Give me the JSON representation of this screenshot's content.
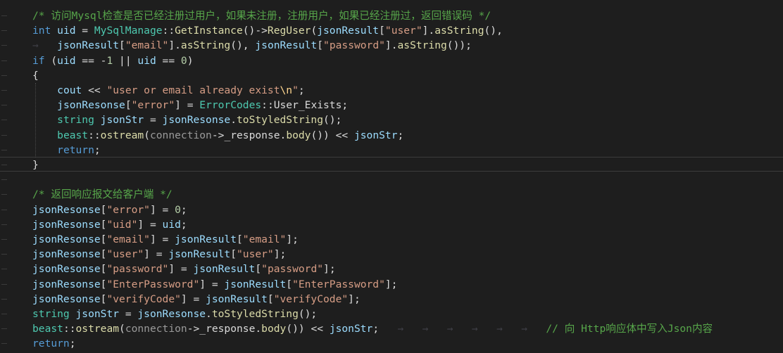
{
  "editor": {
    "background": "#1e1e1e",
    "lines": [
      {
        "tokens": [
          {
            "t": "comment",
            "v": "/* 访问Mysql检查是否已经注册过用户，如果未注册，注册用户，如果已经注册过，返回错误码 */"
          }
        ]
      },
      {
        "tokens": [
          {
            "t": "keyword",
            "v": "int"
          },
          {
            "t": "punct",
            "v": " "
          },
          {
            "t": "var",
            "v": "uid"
          },
          {
            "t": "punct",
            "v": " = "
          },
          {
            "t": "type",
            "v": "MySqlManage"
          },
          {
            "t": "punct",
            "v": "::"
          },
          {
            "t": "func",
            "v": "GetInstance"
          },
          {
            "t": "punct",
            "v": "()->"
          },
          {
            "t": "func",
            "v": "RegUser"
          },
          {
            "t": "punct",
            "v": "("
          },
          {
            "t": "var",
            "v": "jsonResult"
          },
          {
            "t": "punct",
            "v": "["
          },
          {
            "t": "string",
            "v": "\"user\""
          },
          {
            "t": "punct",
            "v": "]."
          },
          {
            "t": "func",
            "v": "asString"
          },
          {
            "t": "punct",
            "v": "(),"
          }
        ]
      },
      {
        "tokens": [
          {
            "t": "tab",
            "v": "→   "
          },
          {
            "t": "var",
            "v": "jsonResult"
          },
          {
            "t": "punct",
            "v": "["
          },
          {
            "t": "string",
            "v": "\"email\""
          },
          {
            "t": "punct",
            "v": "]."
          },
          {
            "t": "func",
            "v": "asString"
          },
          {
            "t": "punct",
            "v": "(), "
          },
          {
            "t": "var",
            "v": "jsonResult"
          },
          {
            "t": "punct",
            "v": "["
          },
          {
            "t": "string",
            "v": "\"password\""
          },
          {
            "t": "punct",
            "v": "]."
          },
          {
            "t": "func",
            "v": "asString"
          },
          {
            "t": "punct",
            "v": "());"
          }
        ]
      },
      {
        "tokens": [
          {
            "t": "keyword",
            "v": "if"
          },
          {
            "t": "punct",
            "v": " ("
          },
          {
            "t": "var",
            "v": "uid"
          },
          {
            "t": "punct",
            "v": " == -"
          },
          {
            "t": "number",
            "v": "1"
          },
          {
            "t": "punct",
            "v": " || "
          },
          {
            "t": "var",
            "v": "uid"
          },
          {
            "t": "punct",
            "v": " == "
          },
          {
            "t": "number",
            "v": "0"
          },
          {
            "t": "punct",
            "v": ")"
          }
        ]
      },
      {
        "tokens": [
          {
            "t": "punct",
            "v": "{"
          }
        ]
      },
      {
        "tokens": [
          {
            "t": "tab",
            "v": "    "
          },
          {
            "t": "var",
            "v": "cout"
          },
          {
            "t": "punct",
            "v": " << "
          },
          {
            "t": "string",
            "v": "\"user or email already exist"
          },
          {
            "t": "escape",
            "v": "\\n"
          },
          {
            "t": "string",
            "v": "\""
          },
          {
            "t": "punct",
            "v": ";"
          }
        ]
      },
      {
        "tokens": [
          {
            "t": "tab",
            "v": "    "
          },
          {
            "t": "var",
            "v": "jsonResonse"
          },
          {
            "t": "punct",
            "v": "["
          },
          {
            "t": "string",
            "v": "\"error\""
          },
          {
            "t": "punct",
            "v": "] = "
          },
          {
            "t": "type",
            "v": "ErrorCodes"
          },
          {
            "t": "punct",
            "v": "::"
          },
          {
            "t": "member",
            "v": "User_Exists"
          },
          {
            "t": "punct",
            "v": ";"
          }
        ]
      },
      {
        "tokens": [
          {
            "t": "tab",
            "v": "    "
          },
          {
            "t": "type",
            "v": "string"
          },
          {
            "t": "punct",
            "v": " "
          },
          {
            "t": "var",
            "v": "jsonStr"
          },
          {
            "t": "punct",
            "v": " = "
          },
          {
            "t": "var",
            "v": "jsonResonse"
          },
          {
            "t": "punct",
            "v": "."
          },
          {
            "t": "func",
            "v": "toStyledString"
          },
          {
            "t": "punct",
            "v": "();"
          }
        ]
      },
      {
        "tokens": [
          {
            "t": "tab",
            "v": "    "
          },
          {
            "t": "type",
            "v": "beast"
          },
          {
            "t": "punct",
            "v": "::"
          },
          {
            "t": "func",
            "v": "ostream"
          },
          {
            "t": "punct",
            "v": "("
          },
          {
            "t": "param",
            "v": "connection"
          },
          {
            "t": "punct",
            "v": "->"
          },
          {
            "t": "member",
            "v": "_response"
          },
          {
            "t": "punct",
            "v": "."
          },
          {
            "t": "func",
            "v": "body"
          },
          {
            "t": "punct",
            "v": "()) << "
          },
          {
            "t": "var",
            "v": "jsonStr"
          },
          {
            "t": "punct",
            "v": ";"
          }
        ]
      },
      {
        "tokens": [
          {
            "t": "tab",
            "v": "    "
          },
          {
            "t": "keyword",
            "v": "return"
          },
          {
            "t": "punct",
            "v": ";"
          }
        ]
      },
      {
        "tokens": [
          {
            "t": "punct",
            "v": "}"
          }
        ]
      },
      {
        "tokens": []
      },
      {
        "tokens": [
          {
            "t": "comment",
            "v": "/* 返回响应报文给客户端 */"
          }
        ]
      },
      {
        "tokens": [
          {
            "t": "var",
            "v": "jsonResonse"
          },
          {
            "t": "punct",
            "v": "["
          },
          {
            "t": "string",
            "v": "\"error\""
          },
          {
            "t": "punct",
            "v": "] = "
          },
          {
            "t": "number",
            "v": "0"
          },
          {
            "t": "punct",
            "v": ";"
          }
        ]
      },
      {
        "tokens": [
          {
            "t": "var",
            "v": "jsonResonse"
          },
          {
            "t": "punct",
            "v": "["
          },
          {
            "t": "string",
            "v": "\"uid\""
          },
          {
            "t": "punct",
            "v": "] = "
          },
          {
            "t": "var",
            "v": "uid"
          },
          {
            "t": "punct",
            "v": ";"
          }
        ]
      },
      {
        "tokens": [
          {
            "t": "var",
            "v": "jsonResonse"
          },
          {
            "t": "punct",
            "v": "["
          },
          {
            "t": "string",
            "v": "\"email\""
          },
          {
            "t": "punct",
            "v": "] = "
          },
          {
            "t": "var",
            "v": "jsonResult"
          },
          {
            "t": "punct",
            "v": "["
          },
          {
            "t": "string",
            "v": "\"email\""
          },
          {
            "t": "punct",
            "v": "];"
          }
        ]
      },
      {
        "tokens": [
          {
            "t": "var",
            "v": "jsonResonse"
          },
          {
            "t": "punct",
            "v": "["
          },
          {
            "t": "string",
            "v": "\"user\""
          },
          {
            "t": "punct",
            "v": "] = "
          },
          {
            "t": "var",
            "v": "jsonResult"
          },
          {
            "t": "punct",
            "v": "["
          },
          {
            "t": "string",
            "v": "\"user\""
          },
          {
            "t": "punct",
            "v": "];"
          }
        ]
      },
      {
        "tokens": [
          {
            "t": "var",
            "v": "jsonResonse"
          },
          {
            "t": "punct",
            "v": "["
          },
          {
            "t": "string",
            "v": "\"password\""
          },
          {
            "t": "punct",
            "v": "] = "
          },
          {
            "t": "var",
            "v": "jsonResult"
          },
          {
            "t": "punct",
            "v": "["
          },
          {
            "t": "string",
            "v": "\"password\""
          },
          {
            "t": "punct",
            "v": "];"
          }
        ]
      },
      {
        "tokens": [
          {
            "t": "var",
            "v": "jsonResonse"
          },
          {
            "t": "punct",
            "v": "["
          },
          {
            "t": "string",
            "v": "\"EnterPassword\""
          },
          {
            "t": "punct",
            "v": "] = "
          },
          {
            "t": "var",
            "v": "jsonResult"
          },
          {
            "t": "punct",
            "v": "["
          },
          {
            "t": "string",
            "v": "\"EnterPassword\""
          },
          {
            "t": "punct",
            "v": "];"
          }
        ]
      },
      {
        "tokens": [
          {
            "t": "var",
            "v": "jsonResonse"
          },
          {
            "t": "punct",
            "v": "["
          },
          {
            "t": "string",
            "v": "\"verifyCode\""
          },
          {
            "t": "punct",
            "v": "] = "
          },
          {
            "t": "var",
            "v": "jsonResult"
          },
          {
            "t": "punct",
            "v": "["
          },
          {
            "t": "string",
            "v": "\"verifyCode\""
          },
          {
            "t": "punct",
            "v": "];"
          }
        ]
      },
      {
        "tokens": [
          {
            "t": "type",
            "v": "string"
          },
          {
            "t": "punct",
            "v": " "
          },
          {
            "t": "var",
            "v": "jsonStr"
          },
          {
            "t": "punct",
            "v": " = "
          },
          {
            "t": "var",
            "v": "jsonResonse"
          },
          {
            "t": "punct",
            "v": "."
          },
          {
            "t": "func",
            "v": "toStyledString"
          },
          {
            "t": "punct",
            "v": "();"
          }
        ]
      },
      {
        "tokens": [
          {
            "t": "type",
            "v": "beast"
          },
          {
            "t": "punct",
            "v": "::"
          },
          {
            "t": "func",
            "v": "ostream"
          },
          {
            "t": "punct",
            "v": "("
          },
          {
            "t": "param",
            "v": "connection"
          },
          {
            "t": "punct",
            "v": "->"
          },
          {
            "t": "member",
            "v": "_response"
          },
          {
            "t": "punct",
            "v": "."
          },
          {
            "t": "func",
            "v": "body"
          },
          {
            "t": "punct",
            "v": "()) << "
          },
          {
            "t": "var",
            "v": "jsonStr"
          },
          {
            "t": "punct",
            "v": ";"
          },
          {
            "t": "tab",
            "v": "   →   →   →   →   →   →   "
          },
          {
            "t": "comment",
            "v": "// 向 Http响应体中写入Json内容"
          }
        ]
      },
      {
        "tokens": [
          {
            "t": "keyword",
            "v": "return"
          },
          {
            "t": "punct",
            "v": ";"
          }
        ]
      }
    ]
  }
}
